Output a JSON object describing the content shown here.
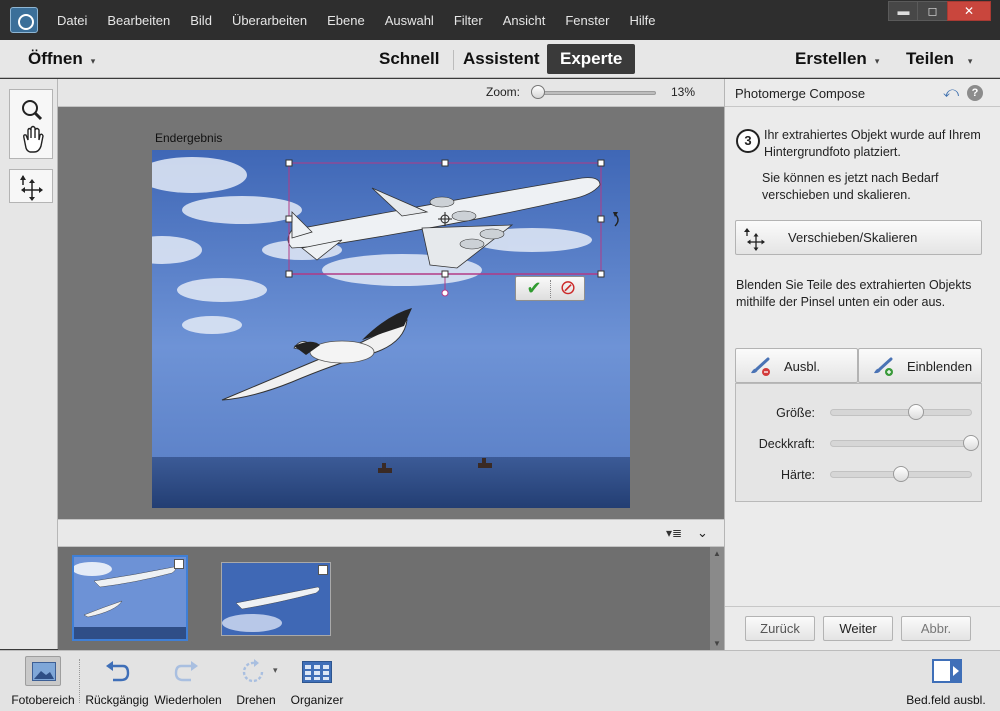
{
  "menubar": {
    "items": [
      "Datei",
      "Bearbeiten",
      "Bild",
      "Überarbeiten",
      "Ebene",
      "Auswahl",
      "Filter",
      "Ansicht",
      "Fenster",
      "Hilfe"
    ]
  },
  "window_controls": {
    "minimize": "▬",
    "maximize": "◻",
    "close": "✕"
  },
  "modebar": {
    "open": "Öffnen",
    "modes": [
      "Schnell",
      "Assistent",
      "Experte"
    ],
    "active_mode": "Experte",
    "create": "Erstellen",
    "share": "Teilen"
  },
  "zoom": {
    "label": "Zoom:",
    "value": "13%",
    "level_percent": 13
  },
  "canvas": {
    "caption": "Endergebnis",
    "confirm_label": "✔",
    "cancel_label": "⊘"
  },
  "panel": {
    "title": "Photomerge Compose",
    "step_number": "3",
    "step_text_1": "Ihr extrahiertes Objekt wurde auf Ihrem Hintergrundfoto platziert.",
    "step_text_2": "Sie können es jetzt nach Bedarf verschieben und skalieren.",
    "move_scale_button": "Verschieben/Skalieren",
    "brush_hint": "Blenden Sie Teile des extrahierten Objekts mithilfe der Pinsel unten ein oder aus.",
    "hide_tab": "Ausbl.",
    "show_tab": "Einblenden",
    "sliders": [
      {
        "label": "Größe:",
        "level": 0.62
      },
      {
        "label": "Deckkraft:",
        "level": 1.0
      },
      {
        "label": "Härte:",
        "level": 0.5
      }
    ],
    "footer": {
      "back": "Zurück",
      "next": "Weiter",
      "cancel": "Abbr."
    }
  },
  "taskbar": {
    "items": [
      {
        "label": "Fotobereich",
        "icon": "photo-bin-icon"
      },
      {
        "label": "Rückgängig",
        "icon": "undo-icon"
      },
      {
        "label": "Wiederholen",
        "icon": "redo-icon"
      },
      {
        "label": "Drehen",
        "icon": "rotate-icon"
      },
      {
        "label": "Organizer",
        "icon": "organizer-icon"
      }
    ],
    "panel_toggle": "Bed.feld ausbl."
  },
  "colors": {
    "accent_blue": "#3f6fb8",
    "selection_magenta": "#b23b86",
    "sky": "#4f76c4",
    "sea": "#2e4c86",
    "active_mode_bg": "#3a3a3a",
    "close_button": "#c9463d"
  }
}
